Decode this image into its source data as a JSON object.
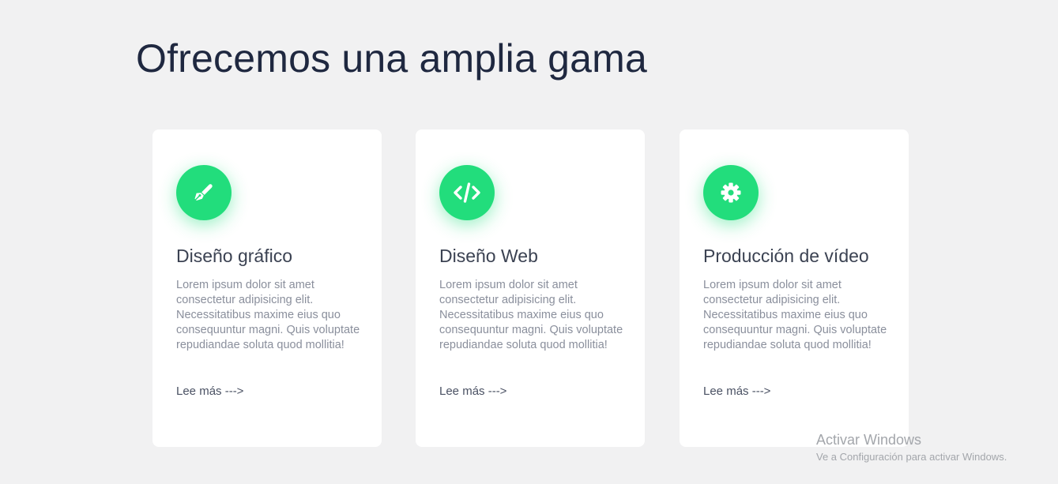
{
  "header": {
    "title": "Ofrecemos una amplia gama"
  },
  "colors": {
    "accent": "#22dd7c",
    "background": "#f1f1f2",
    "card": "#ffffff",
    "title": "#1f2840"
  },
  "cards": [
    {
      "icon": "pen-nib-icon",
      "title": "Diseño gráfico",
      "text": "Lorem ipsum dolor sit amet consectetur adipisicing elit. Necessitatibus maxime eius quo consequuntur magni. Quis voluptate repudiandae soluta quod mollitia!",
      "link": "Lee más --->"
    },
    {
      "icon": "code-icon",
      "title": "Diseño Web",
      "text": "Lorem ipsum dolor sit amet consectetur adipisicing elit. Necessitatibus maxime eius quo consequuntur magni. Quis voluptate repudiandae soluta quod mollitia!",
      "link": "Lee más --->"
    },
    {
      "icon": "gear-icon",
      "title": "Producción de vídeo",
      "text": "Lorem ipsum dolor sit amet consectetur adipisicing elit. Necessitatibus maxime eius quo consequuntur magni. Quis voluptate repudiandae soluta quod mollitia!",
      "link": "Lee más --->"
    }
  ],
  "watermark": {
    "title": "Activar Windows",
    "subtitle": "Ve a Configuración para activar Windows."
  }
}
